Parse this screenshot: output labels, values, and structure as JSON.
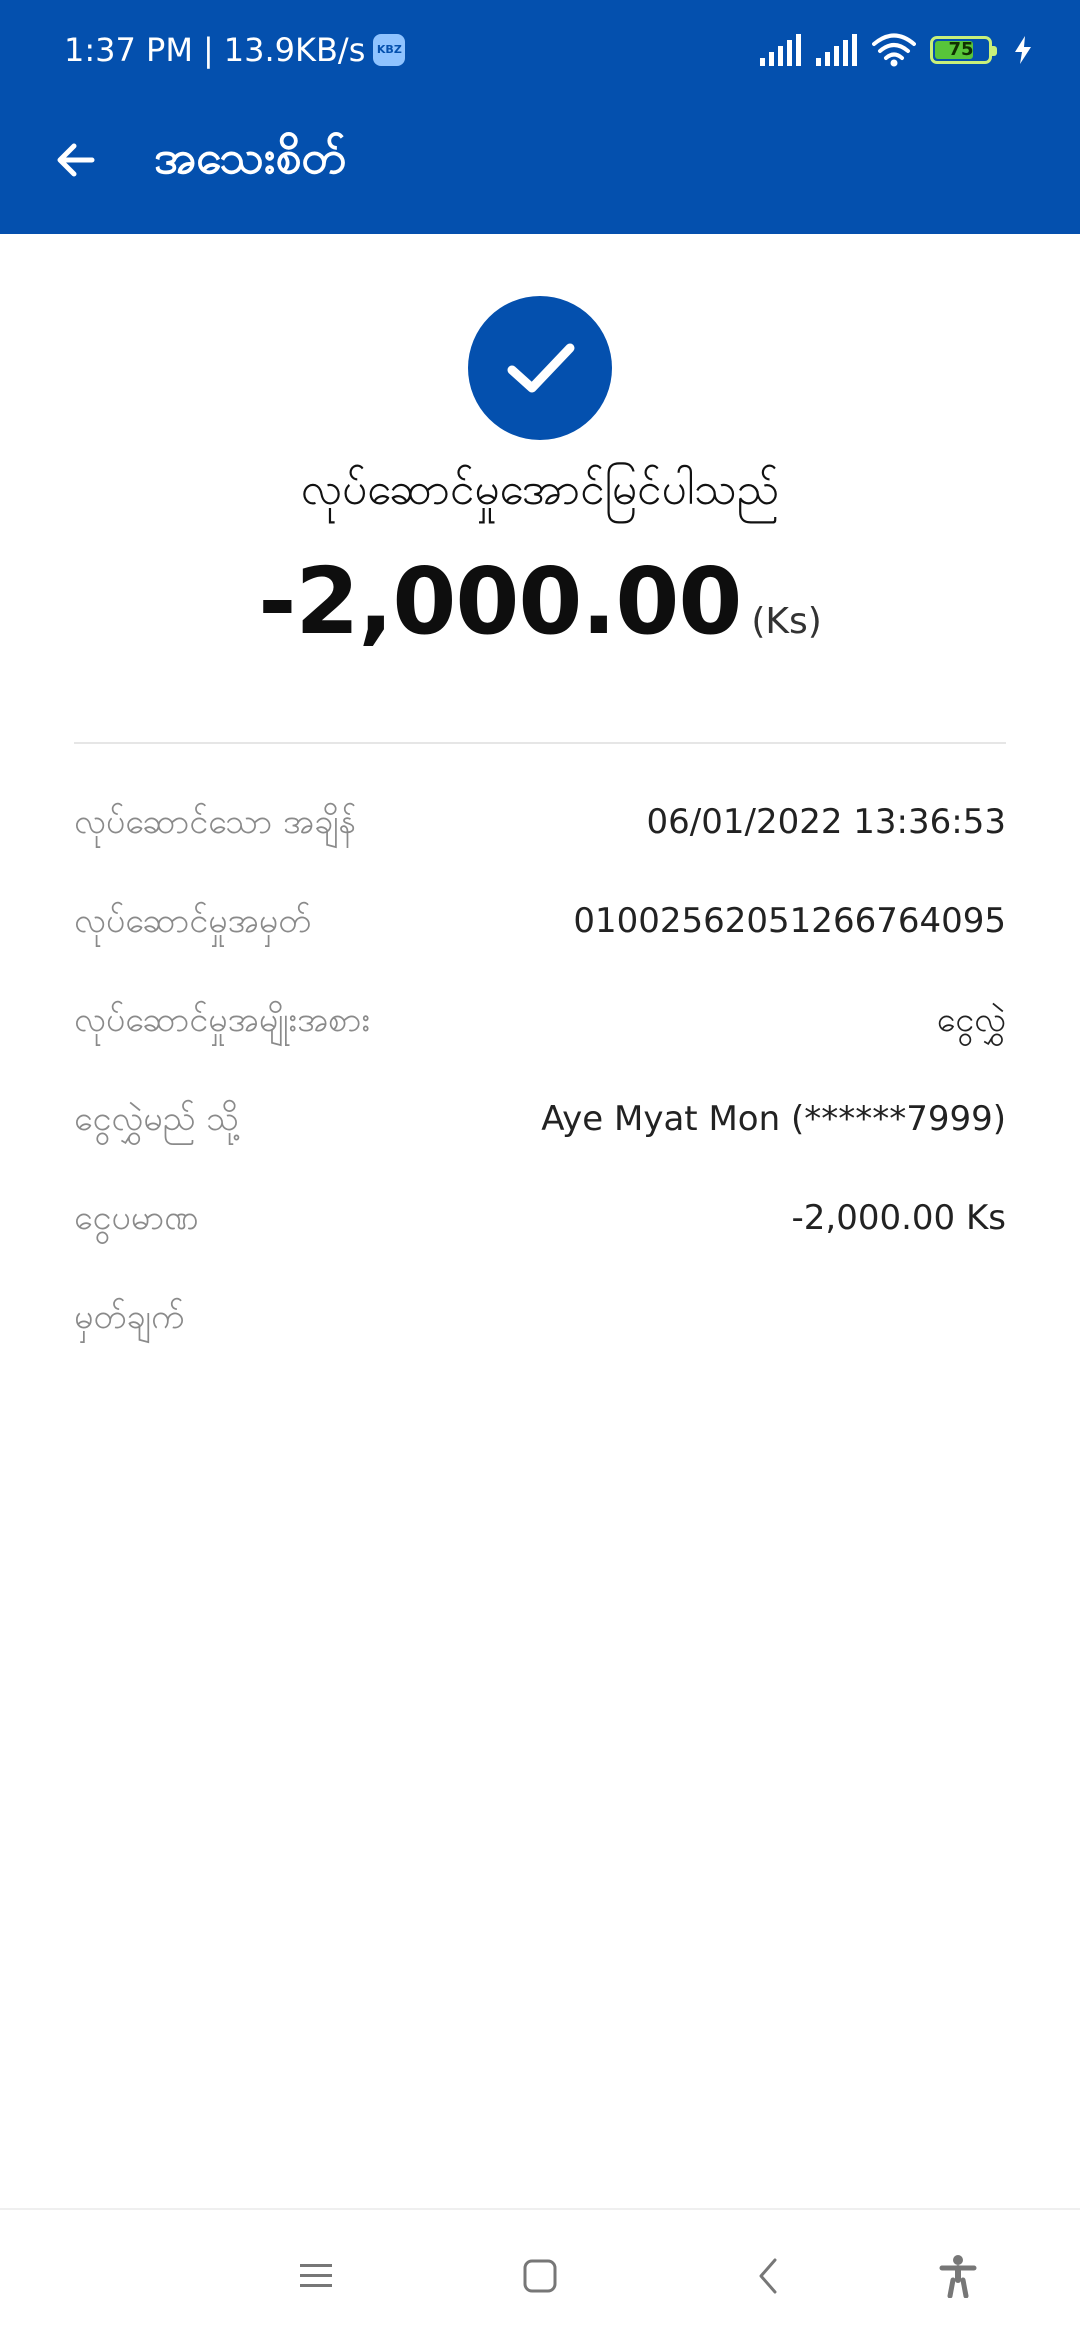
{
  "status_bar": {
    "time": "1:37 PM",
    "separator": "|",
    "speed": "13.9KB/s",
    "app_badge": "KBZ",
    "battery_level": "75",
    "battery_fraction": 0.75
  },
  "header": {
    "title": "အသေးစိတ်",
    "back_icon": "arrow-left-icon",
    "background": "#0450ae"
  },
  "result": {
    "status_icon": "check-circle-icon",
    "message": "လုပ်ဆောင်မှုအောင်မြင်ပါသည်",
    "amount": "-2,000.00",
    "unit": "(Ks)"
  },
  "details": [
    {
      "label": "လုပ်ဆောင်သော အချိန်",
      "value": "06/01/2022 13:36:53"
    },
    {
      "label": "လုပ်ဆောင်မှုအမှတ်",
      "value": "01002562051266764095"
    },
    {
      "label": "လုပ်ဆောင်မှုအမျိုးအစား",
      "value": "ငွေလွှဲ"
    },
    {
      "label": "ငွေလွှဲမည် သို့",
      "value": "Aye Myat Mon (******7999)"
    },
    {
      "label": "ငွေပမာဏ",
      "value": "-2,000.00 Ks"
    },
    {
      "label": "မှတ်ချက်",
      "value": ""
    }
  ],
  "nav_bar": {
    "menu_icon": "menu-icon",
    "home_icon": "home-square-icon",
    "back_icon": "chevron-left-icon",
    "accessibility_icon": "accessibility-icon"
  },
  "colors": {
    "primary": "#0450ae",
    "battery": "#58c53a"
  }
}
